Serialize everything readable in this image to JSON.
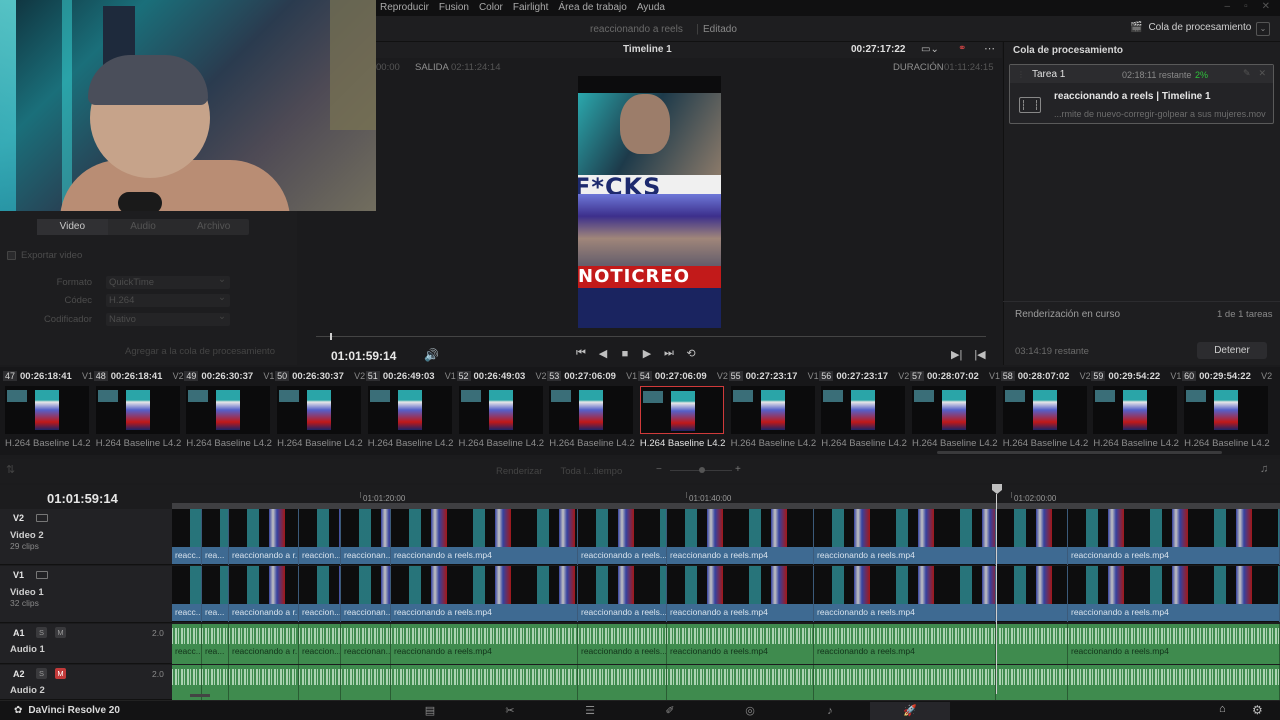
{
  "menu": [
    "Reproducir",
    "Fusion",
    "Color",
    "Fairlight",
    "Área de trabajo",
    "Ayuda"
  ],
  "project": {
    "title": "reaccionando a reels",
    "state": "Editado"
  },
  "header": {
    "render_queue_btn": "Cola de procesamiento"
  },
  "settings": {
    "tabs": [
      "Video",
      "Audio",
      "Archivo"
    ],
    "export_video": "Exportar video",
    "format_label": "Formato",
    "format_value": "QuickTime",
    "codec_label": "Códec",
    "codec_value": "H.264",
    "encoder_label": "Codificador",
    "encoder_value": "Nativo",
    "add_to_queue": "Agregar a la cola de procesamiento"
  },
  "viewer": {
    "timeline_name": "Timeline 1",
    "timecode_top": "00:27:17:22",
    "in_tc": "00:00",
    "salida_label": "SALIDA",
    "salida_tc": "02:11:24:14",
    "duracion_label": "DURACIÓN",
    "duracion_tc": "01:11:24:15",
    "frame_text_top": "F*CKS",
    "frame_text_bottom": "NOTICREO",
    "current_tc": "01:01:59:14"
  },
  "render_queue": {
    "title": "Cola de procesamiento",
    "job_name": "Tarea 1",
    "job_time": "02:18:11 restante",
    "job_pct": "2%",
    "job_title": "reaccionando a reels | Timeline 1",
    "job_file": "...rmite de nuevo-corregir-golpear a sus mujeres.mov",
    "status": "Renderización en curso",
    "count": "1 de 1 tareas",
    "remaining": "03:14:19 restante",
    "stop_button": "Detener"
  },
  "clips": [
    {
      "num": "47",
      "tc": "00:26:18:41",
      "track": "V1",
      "codec": "H.264 Baseline L4.2"
    },
    {
      "num": "48",
      "tc": "00:26:18:41",
      "track": "V2",
      "codec": "H.264 Baseline L4.2"
    },
    {
      "num": "49",
      "tc": "00:26:30:37",
      "track": "V1",
      "codec": "H.264 Baseline L4.2"
    },
    {
      "num": "50",
      "tc": "00:26:30:37",
      "track": "V2",
      "codec": "H.264 Baseline L4.2"
    },
    {
      "num": "51",
      "tc": "00:26:49:03",
      "track": "V1",
      "codec": "H.264 Baseline L4.2"
    },
    {
      "num": "52",
      "tc": "00:26:49:03",
      "track": "V2",
      "codec": "H.264 Baseline L4.2"
    },
    {
      "num": "53",
      "tc": "00:27:06:09",
      "track": "V1",
      "codec": "H.264 Baseline L4.2"
    },
    {
      "num": "54",
      "tc": "00:27:06:09",
      "track": "V2",
      "codec": "H.264 Baseline L4.2"
    },
    {
      "num": "55",
      "tc": "00:27:23:17",
      "track": "V1",
      "codec": "H.264 Baseline L4.2"
    },
    {
      "num": "56",
      "tc": "00:27:23:17",
      "track": "V2",
      "codec": "H.264 Baseline L4.2"
    },
    {
      "num": "57",
      "tc": "00:28:07:02",
      "track": "V1",
      "codec": "H.264 Baseline L4.2"
    },
    {
      "num": "58",
      "tc": "00:28:07:02",
      "track": "V2",
      "codec": "H.264 Baseline L4.2"
    },
    {
      "num": "59",
      "tc": "00:29:54:22",
      "track": "V1",
      "codec": "H.264 Baseline L4.2"
    },
    {
      "num": "60",
      "tc": "00:29:54:22",
      "track": "V2",
      "codec": "H.264 Baseline L4.2"
    }
  ],
  "timeline_toolbar": {
    "render": "Renderizar",
    "range": "Toda l...tiempo"
  },
  "timeline": {
    "current_tc": "01:01:59:14",
    "ruler": [
      "01:01:20:00",
      "01:01:40:00",
      "01:02:00:00"
    ],
    "tracks": [
      {
        "tag": "V2",
        "name": "Video 2",
        "sub": "29 clips"
      },
      {
        "tag": "V1",
        "name": "Video 1",
        "sub": "32 clips"
      },
      {
        "tag": "A1",
        "name": "Audio 1",
        "level": "2.0"
      },
      {
        "tag": "A2",
        "name": "Audio 2",
        "level": "2.0"
      }
    ],
    "clip_labels": [
      "reacc...",
      "rea...",
      "reaccionando a r...",
      "reaccion...",
      "reaccionan...",
      "reaccionando a reels.mp4",
      "reaccionando a reels....",
      "reaccionando a reels.mp4",
      "reaccionando a reels.mp4",
      "reaccionando a reels.mp4"
    ]
  },
  "pagebar": {
    "brand": "DaVinci Resolve 20"
  }
}
